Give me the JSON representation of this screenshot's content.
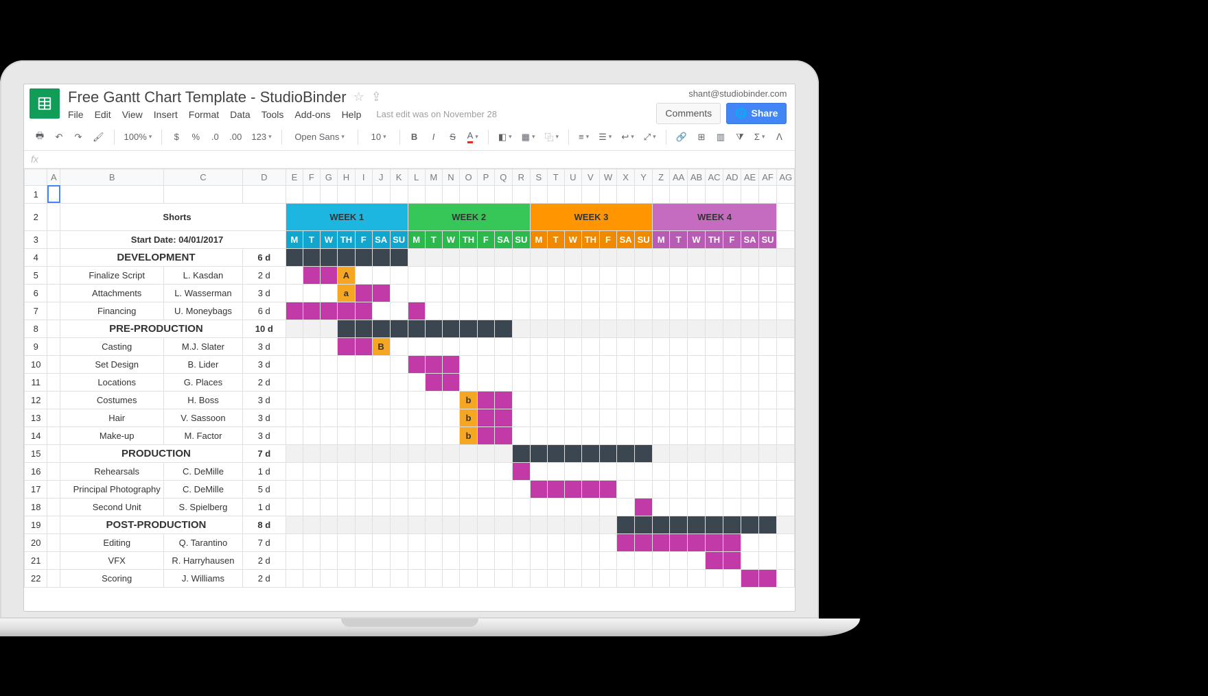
{
  "account": "shant@studiobinder.com",
  "doc_title": "Free Gantt Chart Template - StudioBinder",
  "menus": {
    "file": "File",
    "edit": "Edit",
    "view": "View",
    "insert": "Insert",
    "format": "Format",
    "data": "Data",
    "tools": "Tools",
    "addons": "Add-ons",
    "help": "Help",
    "status": "Last edit was on November 28"
  },
  "buttons": {
    "comments": "Comments",
    "share": "Share"
  },
  "toolbar": {
    "zoom": "100%",
    "font": "Open Sans",
    "font_size": "10",
    "currency": "$",
    "percent": "%",
    "dec_dec": ".0",
    "dec_inc": ".00",
    "more_formats": "123",
    "bold": "B",
    "italic": "I",
    "strike": "S",
    "text_color": "A"
  },
  "fx_label": "fx",
  "columns": [
    "A",
    "B",
    "C",
    "D",
    "E",
    "F",
    "G",
    "H",
    "I",
    "J",
    "K",
    "L",
    "M",
    "N",
    "O",
    "P",
    "Q",
    "R",
    "S",
    "T",
    "U",
    "V",
    "W",
    "X",
    "Y",
    "Z",
    "AA",
    "AB",
    "AC",
    "AD",
    "AE",
    "AF",
    "AG"
  ],
  "weeks": [
    "WEEK 1",
    "WEEK 2",
    "WEEK 3",
    "WEEK 4"
  ],
  "day_labels": [
    "M",
    "T",
    "W",
    "TH",
    "F",
    "SA",
    "SU"
  ],
  "row_numbers": [
    1,
    2,
    3,
    4,
    5,
    6,
    7,
    8,
    9,
    10,
    11,
    12,
    13,
    14,
    15,
    16,
    17,
    18,
    19,
    20,
    21,
    22
  ],
  "sheet": {
    "title": "Shorts",
    "start_label": "Start Date: 04/01/2017",
    "sections": [
      {
        "name": "DEVELOPMENT",
        "total": "6 d",
        "tasks": [
          {
            "name": "Finalize Script",
            "owner": "L. Kasdan",
            "dur": "2 d",
            "bars": [
              {
                "s": 1,
                "e": 2,
                "t": "pink"
              },
              {
                "s": 3,
                "e": 3,
                "t": "gold",
                "label": "A"
              }
            ]
          },
          {
            "name": "Attachments",
            "owner": "L. Wasserman",
            "dur": "3 d",
            "bars": [
              {
                "s": 3,
                "e": 3,
                "t": "gold",
                "label": "a"
              },
              {
                "s": 4,
                "e": 5,
                "t": "pink"
              }
            ]
          },
          {
            "name": "Financing",
            "owner": "U. Moneybags",
            "dur": "6 d",
            "bars": [
              {
                "s": 0,
                "e": 4,
                "t": "pink"
              },
              {
                "s": 7,
                "e": 7,
                "t": "pink"
              }
            ]
          }
        ],
        "header_bars": [
          {
            "s": 0,
            "e": 6,
            "t": "dark"
          }
        ]
      },
      {
        "name": "PRE-PRODUCTION",
        "total": "10 d",
        "tasks": [
          {
            "name": "Casting",
            "owner": "M.J. Slater",
            "dur": "3 d",
            "bars": [
              {
                "s": 3,
                "e": 4,
                "t": "pink"
              },
              {
                "s": 5,
                "e": 5,
                "t": "gold",
                "label": "B"
              }
            ]
          },
          {
            "name": "Set Design",
            "owner": "B. Lider",
            "dur": "3 d",
            "bars": [
              {
                "s": 7,
                "e": 9,
                "t": "pink"
              }
            ]
          },
          {
            "name": "Locations",
            "owner": "G. Places",
            "dur": "2 d",
            "bars": [
              {
                "s": 8,
                "e": 9,
                "t": "pink"
              }
            ]
          },
          {
            "name": "Costumes",
            "owner": "H. Boss",
            "dur": "3 d",
            "bars": [
              {
                "s": 10,
                "e": 10,
                "t": "gold",
                "label": "b"
              },
              {
                "s": 11,
                "e": 12,
                "t": "pink"
              }
            ]
          },
          {
            "name": "Hair",
            "owner": "V. Sassoon",
            "dur": "3 d",
            "bars": [
              {
                "s": 10,
                "e": 10,
                "t": "gold",
                "label": "b"
              },
              {
                "s": 11,
                "e": 12,
                "t": "pink"
              }
            ]
          },
          {
            "name": "Make-up",
            "owner": "M. Factor",
            "dur": "3 d",
            "bars": [
              {
                "s": 10,
                "e": 10,
                "t": "gold",
                "label": "b"
              },
              {
                "s": 11,
                "e": 12,
                "t": "pink"
              }
            ]
          }
        ],
        "header_bars": [
          {
            "s": 3,
            "e": 12,
            "t": "dark"
          }
        ]
      },
      {
        "name": "PRODUCTION",
        "total": "7 d",
        "tasks": [
          {
            "name": "Rehearsals",
            "owner": "C. DeMille",
            "dur": "1 d",
            "bars": [
              {
                "s": 13,
                "e": 13,
                "t": "pink"
              }
            ]
          },
          {
            "name": "Principal Photography",
            "owner": "C. DeMille",
            "dur": "5 d",
            "bars": [
              {
                "s": 14,
                "e": 18,
                "t": "pink"
              }
            ]
          },
          {
            "name": "Second Unit",
            "owner": "S. Spielberg",
            "dur": "1 d",
            "bars": [
              {
                "s": 20,
                "e": 20,
                "t": "pink"
              }
            ]
          }
        ],
        "header_bars": [
          {
            "s": 13,
            "e": 20,
            "t": "dark"
          }
        ]
      },
      {
        "name": "POST-PRODUCTION",
        "total": "8 d",
        "tasks": [
          {
            "name": "Editing",
            "owner": "Q. Tarantino",
            "dur": "7 d",
            "bars": [
              {
                "s": 19,
                "e": 25,
                "t": "pink"
              }
            ]
          },
          {
            "name": "VFX",
            "owner": "R. Harryhausen",
            "dur": "2 d",
            "bars": [
              {
                "s": 24,
                "e": 25,
                "t": "pink"
              }
            ]
          },
          {
            "name": "Scoring",
            "owner": "J. Williams",
            "dur": "2 d",
            "bars": [
              {
                "s": 26,
                "e": 27,
                "t": "pink"
              }
            ]
          }
        ],
        "header_bars": [
          {
            "s": 19,
            "e": 27,
            "t": "dark"
          }
        ]
      }
    ]
  },
  "chart_data": {
    "type": "gantt",
    "title": "Shorts",
    "start_date": "04/01/2017",
    "columns_unit": "day",
    "weeks": 4,
    "days_per_week": 7,
    "day_labels": [
      "M",
      "T",
      "W",
      "TH",
      "F",
      "SA",
      "SU"
    ],
    "week_colors": {
      "WEEK 1": "#1cb6e0",
      "WEEK 2": "#37c759",
      "WEEK 3": "#ff9500",
      "WEEK 4": "#c56bc0"
    },
    "bar_colors": {
      "section": "#3c4650",
      "task": "#c23aa7",
      "milestone": "#f5a623"
    },
    "sections": [
      {
        "name": "DEVELOPMENT",
        "duration_days": 6,
        "span": [
          0,
          6
        ],
        "tasks": [
          {
            "name": "Finalize Script",
            "owner": "L. Kasdan",
            "duration_days": 2,
            "span": [
              1,
              2
            ],
            "milestone": {
              "day": 3,
              "label": "A"
            }
          },
          {
            "name": "Attachments",
            "owner": "L. Wasserman",
            "duration_days": 3,
            "milestone": {
              "day": 3,
              "label": "a"
            },
            "span": [
              4,
              5
            ]
          },
          {
            "name": "Financing",
            "owner": "U. Moneybags",
            "duration_days": 6,
            "spans": [
              [
                0,
                4
              ],
              [
                7,
                7
              ]
            ]
          }
        ]
      },
      {
        "name": "PRE-PRODUCTION",
        "duration_days": 10,
        "span": [
          3,
          12
        ],
        "tasks": [
          {
            "name": "Casting",
            "owner": "M.J. Slater",
            "duration_days": 3,
            "span": [
              3,
              4
            ],
            "milestone": {
              "day": 5,
              "label": "B"
            }
          },
          {
            "name": "Set Design",
            "owner": "B. Lider",
            "duration_days": 3,
            "span": [
              7,
              9
            ]
          },
          {
            "name": "Locations",
            "owner": "G. Places",
            "duration_days": 2,
            "span": [
              8,
              9
            ]
          },
          {
            "name": "Costumes",
            "owner": "H. Boss",
            "duration_days": 3,
            "milestone": {
              "day": 10,
              "label": "b"
            },
            "span": [
              11,
              12
            ]
          },
          {
            "name": "Hair",
            "owner": "V. Sassoon",
            "duration_days": 3,
            "milestone": {
              "day": 10,
              "label": "b"
            },
            "span": [
              11,
              12
            ]
          },
          {
            "name": "Make-up",
            "owner": "M. Factor",
            "duration_days": 3,
            "milestone": {
              "day": 10,
              "label": "b"
            },
            "span": [
              11,
              12
            ]
          }
        ]
      },
      {
        "name": "PRODUCTION",
        "duration_days": 7,
        "span": [
          13,
          20
        ],
        "tasks": [
          {
            "name": "Rehearsals",
            "owner": "C. DeMille",
            "duration_days": 1,
            "span": [
              13,
              13
            ]
          },
          {
            "name": "Principal Photography",
            "owner": "C. DeMille",
            "duration_days": 5,
            "span": [
              14,
              18
            ]
          },
          {
            "name": "Second Unit",
            "owner": "S. Spielberg",
            "duration_days": 1,
            "span": [
              20,
              20
            ]
          }
        ]
      },
      {
        "name": "POST-PRODUCTION",
        "duration_days": 8,
        "span": [
          19,
          27
        ],
        "tasks": [
          {
            "name": "Editing",
            "owner": "Q. Tarantino",
            "duration_days": 7,
            "span": [
              19,
              25
            ]
          },
          {
            "name": "VFX",
            "owner": "R. Harryhausen",
            "duration_days": 2,
            "span": [
              24,
              25
            ]
          },
          {
            "name": "Scoring",
            "owner": "J. Williams",
            "duration_days": 2,
            "span": [
              26,
              27
            ]
          }
        ]
      }
    ]
  }
}
